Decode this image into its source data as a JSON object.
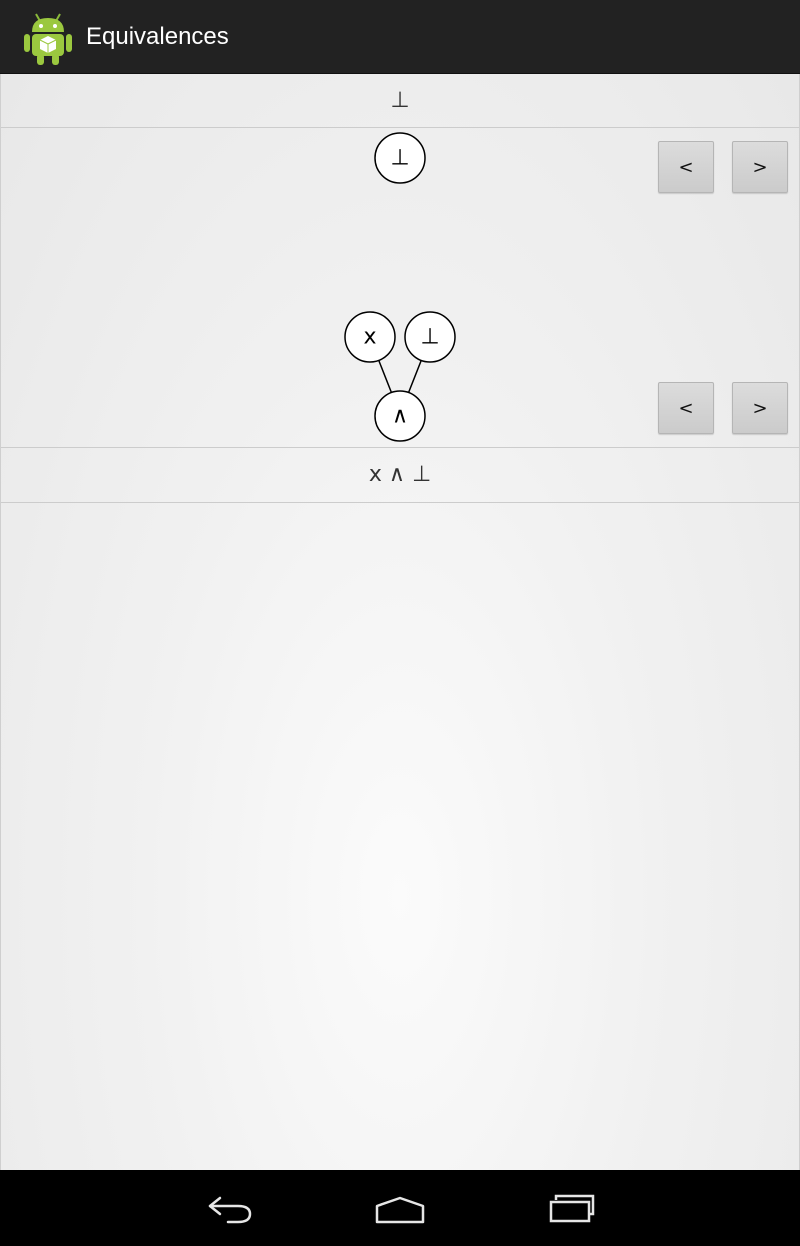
{
  "app": {
    "title": "Equivalences",
    "icon": "android-robot-icon"
  },
  "formulas": {
    "top": "⊥",
    "bottom": "x ∧ ⊥"
  },
  "tree_top": {
    "root": "⊥"
  },
  "tree_bottom": {
    "root": "∧",
    "children": [
      "x",
      "⊥"
    ]
  },
  "controls": {
    "top_prev": "<",
    "top_next": ">",
    "bottom_prev": "<",
    "bottom_next": ">"
  },
  "system_nav": {
    "back_icon": "back-icon",
    "home_icon": "home-icon",
    "recents_icon": "recent-apps-icon"
  }
}
